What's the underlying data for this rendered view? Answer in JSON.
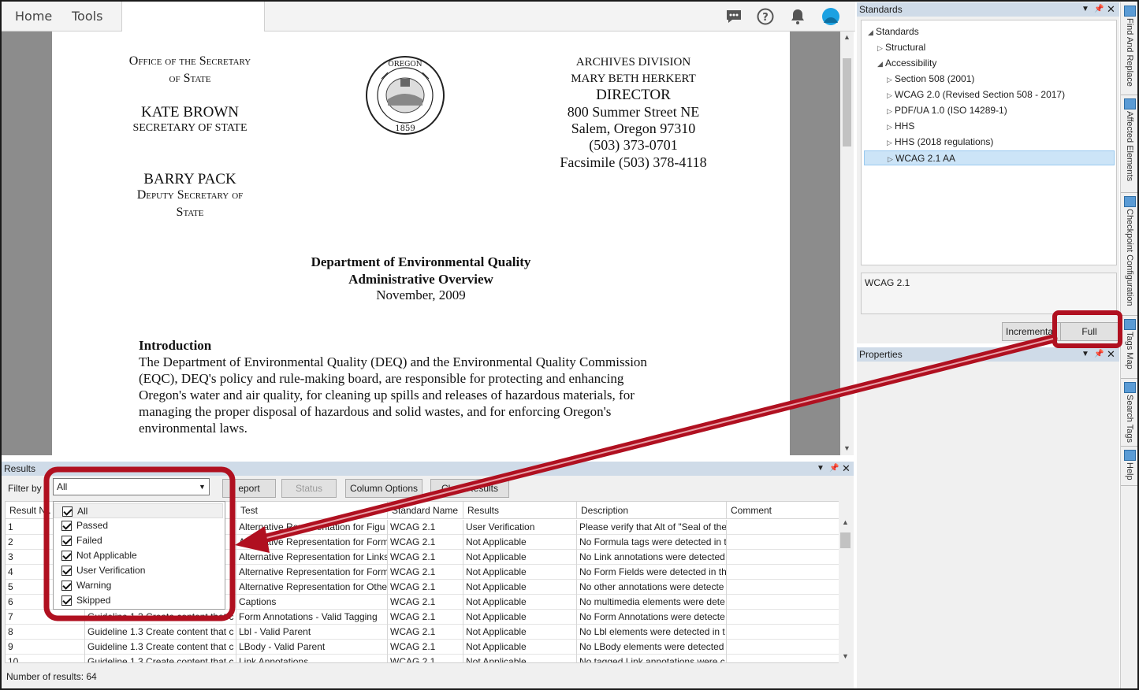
{
  "topbar": {
    "tabs": [
      "Home",
      "Tools"
    ]
  },
  "document": {
    "left_header": [
      "Office of the Secretary",
      "of State",
      "KATE BROWN",
      "SECRETARY OF STATE",
      "BARRY PACK",
      "Deputy Secretary of",
      "State"
    ],
    "seal_text": [
      "STATE OF OREGON",
      "1859"
    ],
    "right_header": [
      "ARCHIVES DIVISION",
      "MARY BETH HERKERT",
      "DIRECTOR",
      "800 Summer Street NE",
      "Salem, Oregon 97310",
      "(503) 373-0701",
      "Facsimile (503) 378-4118"
    ],
    "title_lines": [
      "Department of Environmental Quality",
      "Administrative Overview",
      "November, 2009"
    ],
    "intro_heading": "Introduction",
    "intro_lines": [
      "The Department of Environmental Quality (DEQ) and the Environmental Quality Commission",
      "(EQC), DEQ's policy and rule-making board, are responsible for protecting and enhancing",
      "Oregon's water and air quality, for cleaning up spills and releases of hazardous materials, for",
      "managing the proper disposal of hazardous and solid wastes, and for enforcing Oregon's",
      "environmental laws."
    ]
  },
  "results": {
    "panel_title": "Results",
    "filter_label": "Filter by",
    "filter_value": "All",
    "buttons": {
      "report": "eport",
      "status": "Status",
      "column_options": "Column Options",
      "clear_results": "Clear Results"
    },
    "columns": [
      "Result N..",
      "",
      "Test",
      "Standard Name",
      "Results",
      "Description",
      "Comment"
    ],
    "rows": [
      [
        "1",
        "",
        "Alternative Representation for Figu",
        "WCAG 2.1",
        "User Verification",
        "Please verify that Alt of \"Seal of the",
        ""
      ],
      [
        "2",
        "",
        "Alternative Representation for Form",
        "WCAG 2.1",
        "Not Applicable",
        "No Formula tags were detected in t",
        ""
      ],
      [
        "3",
        "",
        "Alternative Representation for Links",
        "WCAG 2.1",
        "Not Applicable",
        "No Link annotations were detected",
        ""
      ],
      [
        "4",
        "",
        "Alternative Representation for Form",
        "WCAG 2.1",
        "Not Applicable",
        "No Form Fields were detected in th",
        ""
      ],
      [
        "5",
        "",
        "Alternative Representation for Othe",
        "WCAG 2.1",
        "Not Applicable",
        "No other annotations were detecte",
        ""
      ],
      [
        "6",
        "",
        "Captions",
        "WCAG 2.1",
        "Not Applicable",
        "No multimedia elements were dete",
        ""
      ],
      [
        "7",
        "Guideline 1.3 Create content that c",
        "Form Annotations - Valid Tagging",
        "WCAG 2.1",
        "Not Applicable",
        "No Form Annotations were detecte",
        ""
      ],
      [
        "8",
        "Guideline 1.3 Create content that c",
        "Lbl - Valid Parent",
        "WCAG 2.1",
        "Not Applicable",
        "No Lbl elements were detected in t",
        ""
      ],
      [
        "9",
        "Guideline 1.3 Create content that c",
        "LBody - Valid Parent",
        "WCAG 2.1",
        "Not Applicable",
        "No LBody elements were detected",
        ""
      ],
      [
        "10",
        "Guideline 1.3 Create content that c",
        "Link Annotations",
        "WCAG 2.1",
        "Not Applicable",
        "No tagged Link annotations were c",
        ""
      ]
    ],
    "count_text": "Number of results: 64",
    "filter_options": [
      "All",
      "Passed",
      "Failed",
      "Not Applicable",
      "User Verification",
      "Warning",
      "Skipped"
    ]
  },
  "standards": {
    "panel_title": "Standards",
    "tree": [
      {
        "label": "Standards",
        "level": 0,
        "arrow": "expanded"
      },
      {
        "label": "Structural",
        "level": 1,
        "arrow": "collapsed"
      },
      {
        "label": "Accessibility",
        "level": 1,
        "arrow": "expanded"
      },
      {
        "label": "Section 508 (2001)",
        "level": 2,
        "arrow": "collapsed"
      },
      {
        "label": "WCAG 2.0 (Revised Section 508 - 2017)",
        "level": 2,
        "arrow": "collapsed"
      },
      {
        "label": "PDF/UA 1.0 (ISO 14289-1)",
        "level": 2,
        "arrow": "collapsed"
      },
      {
        "label": "HHS",
        "level": 2,
        "arrow": "collapsed"
      },
      {
        "label": "HHS (2018 regulations)",
        "level": 2,
        "arrow": "collapsed"
      },
      {
        "label": "WCAG 2.1 AA",
        "level": 2,
        "arrow": "collapsed",
        "selected": true
      }
    ],
    "description": "WCAG 2.1",
    "incremental_label": "Incremental",
    "full_label": "Full"
  },
  "properties": {
    "panel_title": "Properties"
  },
  "side_tabs": [
    "Find And Replace",
    "Affected Elements",
    "Checkpoint Configuration",
    "Tags Map",
    "Search Tags",
    "Help"
  ],
  "colors": {
    "panel_header": "#cfdbe8",
    "selection": "#cce4f7",
    "annotation_red": "#b01020",
    "accent_blue": "#1ba1e2"
  }
}
